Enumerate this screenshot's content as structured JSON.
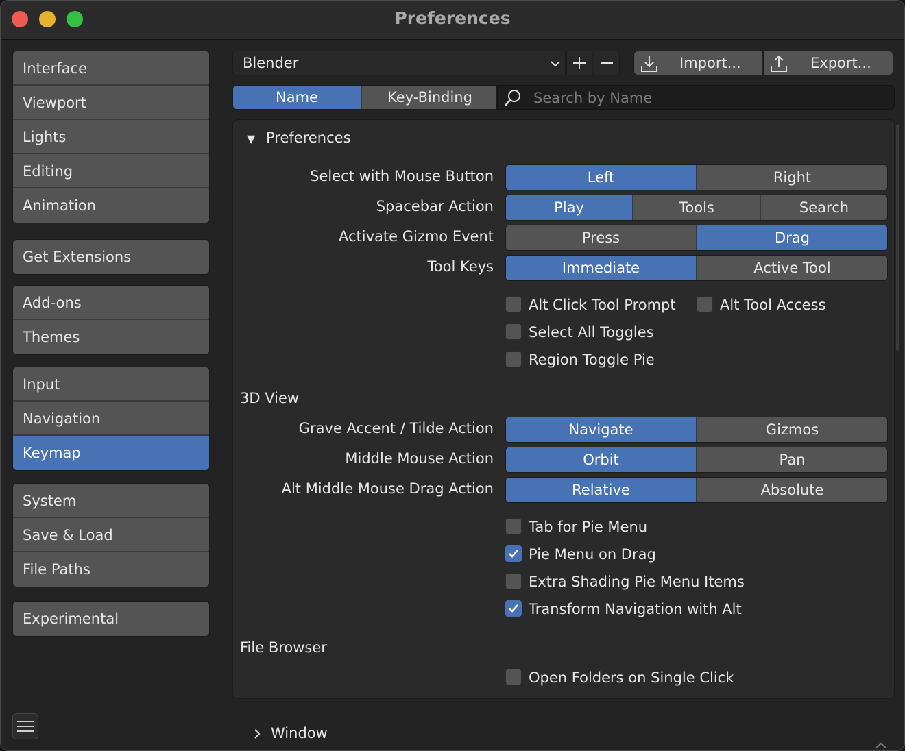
{
  "window": {
    "title": "Preferences"
  },
  "sidebar": {
    "groups": [
      [
        "Interface",
        "Viewport",
        "Lights",
        "Editing",
        "Animation"
      ],
      [
        "Get Extensions"
      ],
      [
        "Add-ons",
        "Themes"
      ],
      [
        "Input",
        "Navigation",
        "Keymap"
      ],
      [
        "System",
        "Save & Load",
        "File Paths"
      ],
      [
        "Experimental"
      ]
    ],
    "active": "Keymap"
  },
  "header": {
    "preset_value": "Blender",
    "import_label": "Import...",
    "export_label": "Export...",
    "filter_tabs": [
      "Name",
      "Key-Binding"
    ],
    "filter_active": "Name",
    "search_placeholder": "Search by Name"
  },
  "panel": {
    "title": "Preferences",
    "rows": [
      {
        "label": "Select with Mouse Button",
        "options": [
          "Left",
          "Right"
        ],
        "selected": "Left"
      },
      {
        "label": "Spacebar Action",
        "options": [
          "Play",
          "Tools",
          "Search"
        ],
        "selected": "Play"
      },
      {
        "label": "Activate Gizmo Event",
        "options": [
          "Press",
          "Drag"
        ],
        "selected": "Drag"
      },
      {
        "label": "Tool Keys",
        "options": [
          "Immediate",
          "Active Tool"
        ],
        "selected": "Immediate"
      }
    ],
    "checks_general": [
      {
        "label": "Alt Click Tool Prompt",
        "checked": false
      },
      {
        "label": "Alt Tool Access",
        "checked": false
      },
      {
        "label": "Select All Toggles",
        "checked": false
      },
      {
        "label": "Region Toggle Pie",
        "checked": false
      }
    ],
    "view3d_title": "3D View",
    "view3d_rows": [
      {
        "label": "Grave Accent / Tilde Action",
        "options": [
          "Navigate",
          "Gizmos"
        ],
        "selected": "Navigate"
      },
      {
        "label": "Middle Mouse Action",
        "options": [
          "Orbit",
          "Pan"
        ],
        "selected": "Orbit"
      },
      {
        "label": "Alt Middle Mouse Drag Action",
        "options": [
          "Relative",
          "Absolute"
        ],
        "selected": "Relative"
      }
    ],
    "checks_view3d": [
      {
        "label": "Tab for Pie Menu",
        "checked": false
      },
      {
        "label": "Pie Menu on Drag",
        "checked": true
      },
      {
        "label": "Extra Shading Pie Menu Items",
        "checked": false
      },
      {
        "label": "Transform Navigation with Alt",
        "checked": true
      }
    ],
    "file_browser_title": "File Browser",
    "checks_file_browser": [
      {
        "label": "Open Folders on Single Click",
        "checked": false
      }
    ]
  },
  "collapsed_sections": [
    "Window"
  ],
  "colors": {
    "accent": "#4772b3",
    "button": "#545454",
    "panel": "#2a2a2a",
    "background": "#232323"
  }
}
